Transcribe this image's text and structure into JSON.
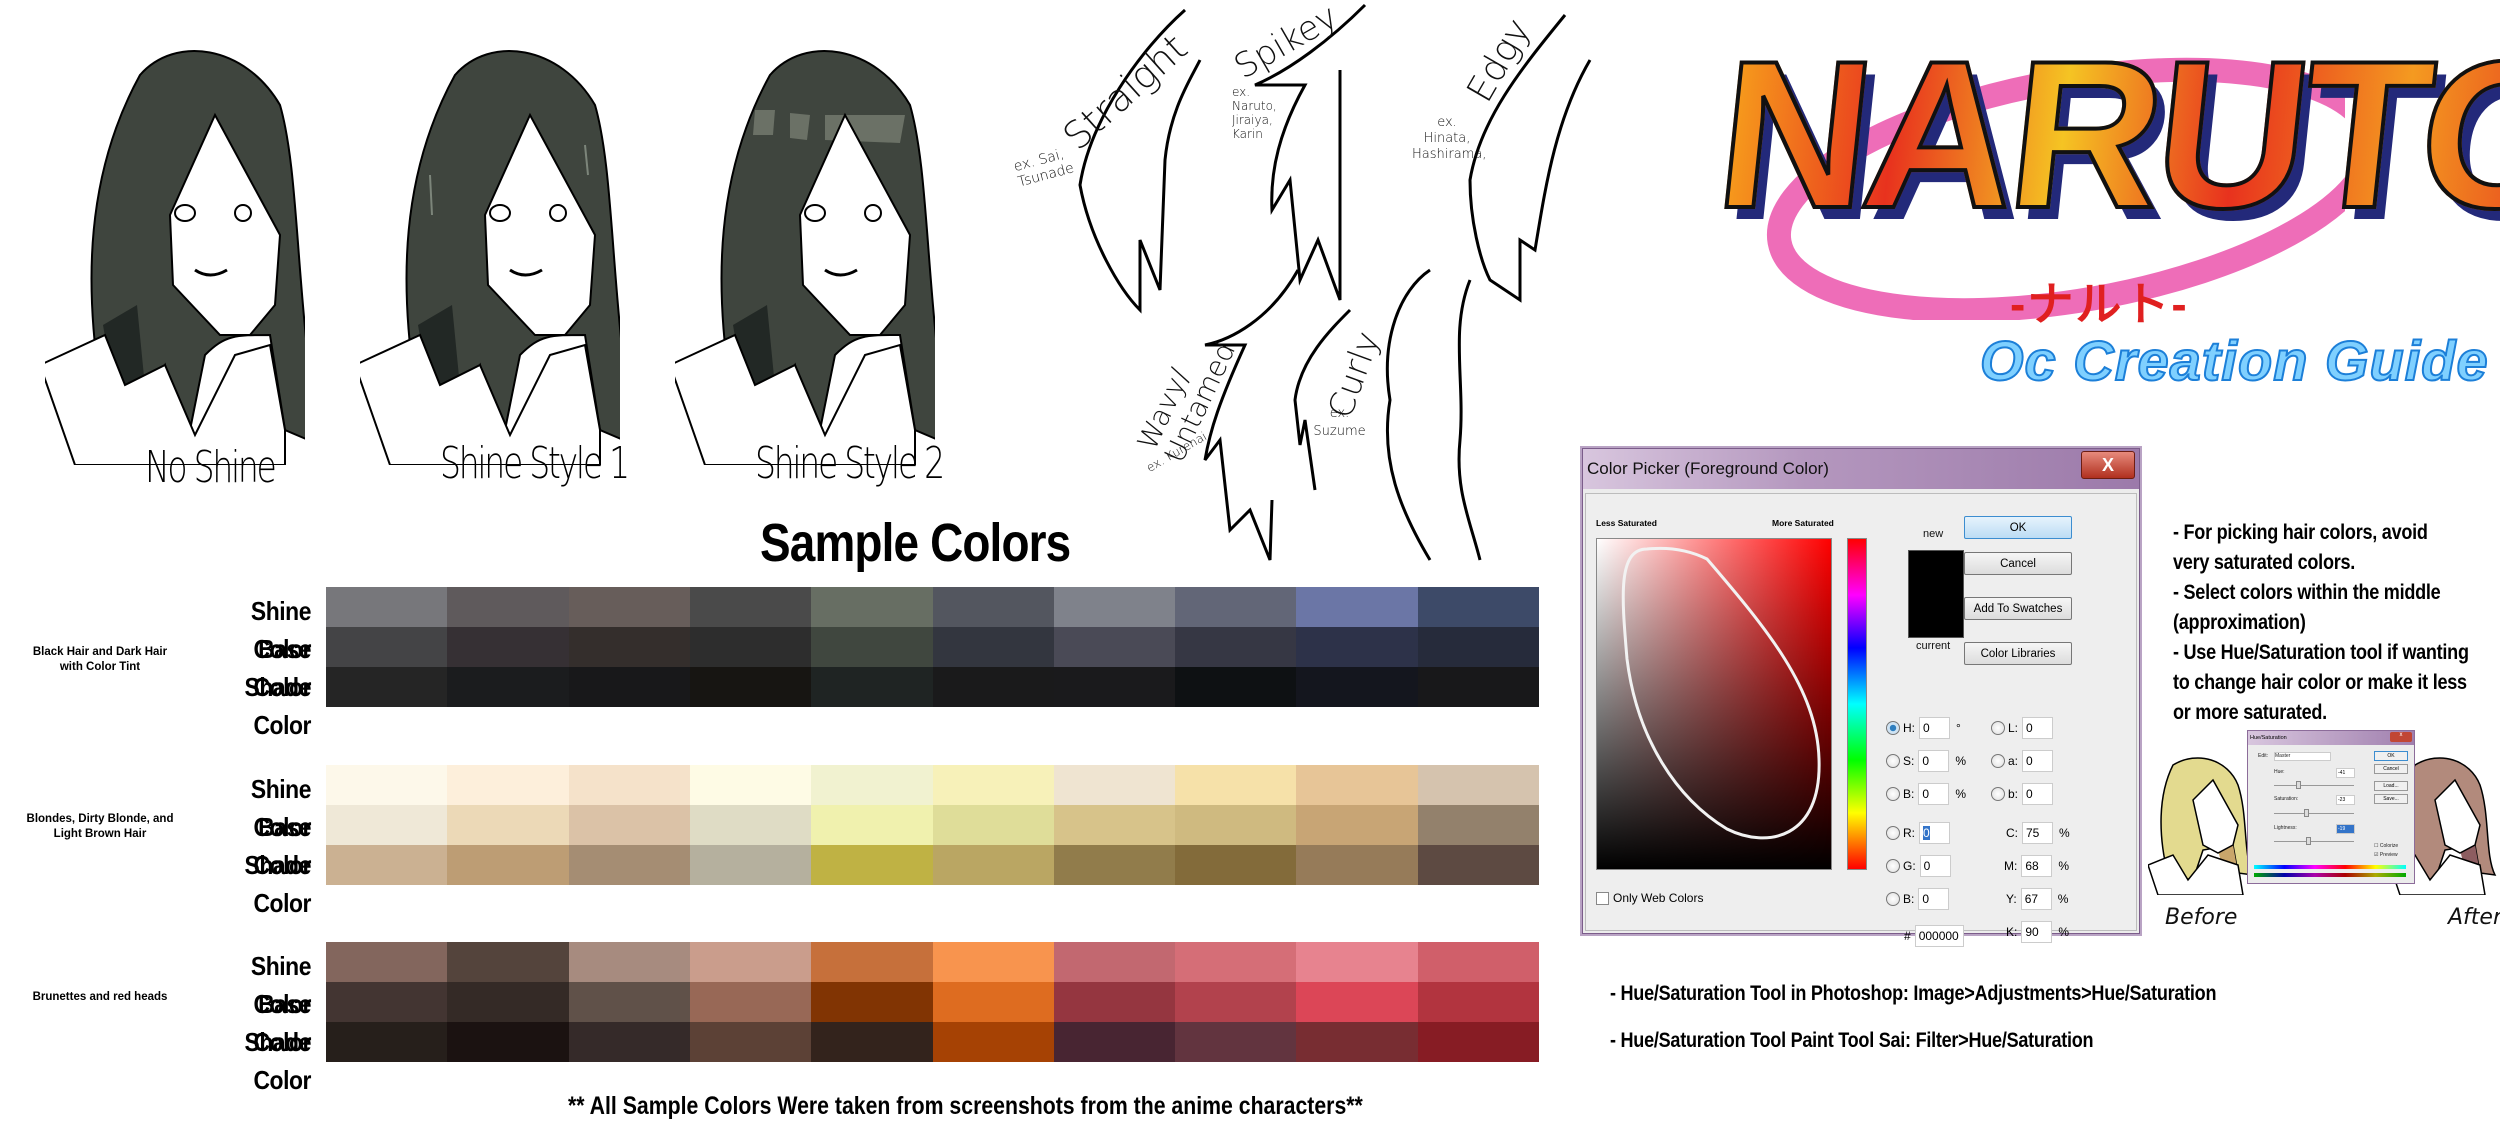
{
  "heads": [
    {
      "label": "No Shine",
      "hair_color": "#3f453e",
      "shade_color": "#222825",
      "shine": "none"
    },
    {
      "label": "Shine Style 1",
      "hair_color": "#3f453e",
      "shade_color": "#222825",
      "shine": "streaks"
    },
    {
      "label": "Shine Style 2",
      "hair_color": "#3f453e",
      "shade_color": "#222825",
      "shine": "band",
      "shine_color": "#6b7166"
    }
  ],
  "hair_types": [
    {
      "name": "Straight",
      "examples": "ex. Sai, Tsunade"
    },
    {
      "name": "Spikey",
      "examples": "ex. Naruto, Jiraiya, Karin"
    },
    {
      "name": "Edgy",
      "examples": "ex. Hinata, Hashirama,"
    },
    {
      "name": "Wavy/ Untamed",
      "examples": "ex. Kurenai"
    },
    {
      "name": "Curly",
      "examples": "ex. Suzume"
    }
  ],
  "logo": {
    "title": "NARUTO",
    "japanese": "-ナルト-",
    "subtitle": "Oc Creation Guide"
  },
  "sample_colors": {
    "title": "Sample Colors",
    "row_labels": [
      "Shine Color",
      "Base Color",
      "Shade Color"
    ],
    "groups": [
      {
        "label": "Black Hair and Dark Hair with Color Tint",
        "rows": [
          [
            "#77777b",
            "#5f5a5c",
            "#675d5a",
            "#4a4a4a",
            "#676e63",
            "#53565f",
            "#7f828b",
            "#626677",
            "#6b76a6",
            "#3d4a68"
          ],
          [
            "#444446",
            "#363034",
            "#342e2c",
            "#2d2d2d",
            "#40473f",
            "#33363f",
            "#4a4a56",
            "#363744",
            "#2d3249",
            "#262b3b"
          ],
          [
            "#252525",
            "#1b1c1e",
            "#18181a",
            "#171512",
            "#1f2423",
            "#1a1a1b",
            "#1a1a1c",
            "#0e1113",
            "#14161e",
            "#18181a"
          ]
        ]
      },
      {
        "label": "Blondes, Dirty Blonde, and Light Brown Hair",
        "rows": [
          [
            "#fdf8ea",
            "#fdefdb",
            "#f5e2ca",
            "#fefbe5",
            "#f1f2d0",
            "#f7f1b9",
            "#efe4d1",
            "#f6e1a9",
            "#e7c597",
            "#d5c3ae"
          ],
          [
            "#efe8d7",
            "#ecd9b7",
            "#dbc2a7",
            "#dfdcc5",
            "#f0f1ae",
            "#dfdd99",
            "#d7c38a",
            "#cfba80",
            "#c8a575",
            "#93816c"
          ],
          [
            "#cbb192",
            "#bd9d74",
            "#a58d73",
            "#b5b09e",
            "#bfb244",
            "#baa663",
            "#917c4b",
            "#836b3a",
            "#967b59",
            "#5d4a42"
          ]
        ]
      },
      {
        "label": "Brunettes and red heads",
        "rows": [
          [
            "#83665d",
            "#54443c",
            "#a78b7f",
            "#ca9d8c",
            "#c6703b",
            "#f8944e",
            "#c26870",
            "#d56e77",
            "#e7838f",
            "#d05f6a"
          ],
          [
            "#433532",
            "#342a26",
            "#605149",
            "#986856",
            "#813403",
            "#de6c20",
            "#953640",
            "#b2424d",
            "#dc4657",
            "#b2343f"
          ],
          [
            "#261f1b",
            "#1b1211",
            "#352a29",
            "#5c4136",
            "#33231c",
            "#a64204",
            "#482532",
            "#62343f",
            "#782d32",
            "#871c24"
          ]
        ]
      }
    ],
    "footer": "** All Sample Colors Were taken from screenshots from the anime characters**"
  },
  "color_picker": {
    "title": "Color Picker (Foreground Color)",
    "close": "X",
    "less_saturated": "Less Saturated",
    "more_saturated": "More Saturated",
    "new_label": "new",
    "current_label": "current",
    "buttons": {
      "ok": "OK",
      "cancel": "Cancel",
      "add_to_swatches": "Add To Swatches",
      "color_libraries": "Color Libraries"
    },
    "only_web_colors": "Only Web Colors",
    "hsb": {
      "H": "0",
      "S": "0",
      "B": "0"
    },
    "rgb": {
      "R": "0",
      "G": "0",
      "B": "0"
    },
    "lab": {
      "L": "0",
      "a": "0",
      "b": "0"
    },
    "cmyk": {
      "C": "75",
      "M": "68",
      "Y": "67",
      "K": "90"
    },
    "hex": "000000",
    "units": {
      "deg": "°",
      "pct": "%"
    },
    "selected_mode": "H"
  },
  "notes": {
    "tips": [
      "- For picking hair colors, avoid",
      "very saturated colors.",
      "- Select colors within the middle",
      "(approximation)",
      "- Use Hue/Saturation tool if wanting",
      "to change hair color or make it less",
      "or more saturated."
    ],
    "photoshop": "- Hue/Saturation Tool in Photoshop: Image>Adjustments>Hue/Saturation",
    "sai": "- Hue/Saturation Tool Paint Tool Sai: Filter>Hue/Saturation"
  },
  "hue_sat_dialog": {
    "title": "Hue/Saturation",
    "edit_label": "Edit:",
    "edit_value": "Master",
    "hue_label": "Hue:",
    "hue": "-41",
    "saturation_label": "Saturation:",
    "saturation": "-23",
    "lightness_label": "Lightness:",
    "lightness": "-19",
    "buttons": [
      "OK",
      "Cancel",
      "Load...",
      "Save..."
    ],
    "colorize": "Colorize",
    "preview": "Preview"
  },
  "before_after": {
    "before_label": "Before",
    "before_hair": "#e3da8f",
    "before_shade": "#c9a66b",
    "after_label": "After",
    "after_hair": "#b28a7c",
    "after_shade": "#8d5d60"
  }
}
